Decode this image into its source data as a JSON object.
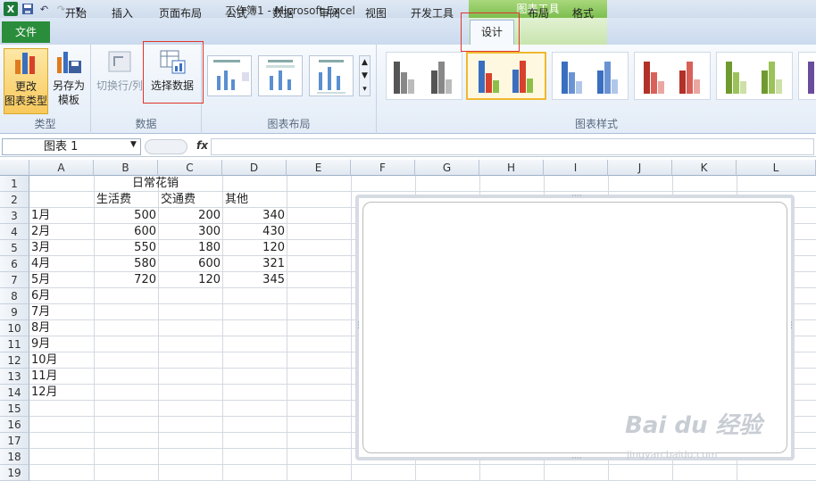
{
  "window": {
    "title": "工作簿1 - Microsoft Excel",
    "context_tab": "图表工具"
  },
  "tabs": [
    "文件",
    "开始",
    "插入",
    "页面布局",
    "公式",
    "数据",
    "审阅",
    "视图",
    "开发工具",
    "设计",
    "布局",
    "格式"
  ],
  "ribbon": {
    "change_type": "更改\n图表类型",
    "save_template": "另存为\n模板",
    "group_type": "类型",
    "switch_rowcol": "切换行/列",
    "select_data": "选择数据",
    "group_data": "数据",
    "group_layout": "图表布局",
    "group_style": "图表样式"
  },
  "formula_bar": {
    "name_box": "图表 1",
    "fx": "fx",
    "value": ""
  },
  "columns": [
    "A",
    "B",
    "C",
    "D",
    "E",
    "F",
    "G",
    "H",
    "I",
    "J",
    "K",
    "L"
  ],
  "rows": [
    "1",
    "2",
    "3",
    "4",
    "5",
    "6",
    "7",
    "8",
    "9",
    "10",
    "11",
    "12",
    "13",
    "14",
    "15",
    "16",
    "17",
    "18",
    "19"
  ],
  "sheet": {
    "title": "日常花销",
    "headers": [
      "生活费",
      "交通费",
      "其他"
    ],
    "data": [
      {
        "month": "1月",
        "a": "500",
        "b": "200",
        "c": "340"
      },
      {
        "month": "2月",
        "a": "600",
        "b": "300",
        "c": "430"
      },
      {
        "month": "3月",
        "a": "550",
        "b": "180",
        "c": "120"
      },
      {
        "month": "4月",
        "a": "580",
        "b": "600",
        "c": "321"
      },
      {
        "month": "5月",
        "a": "720",
        "b": "120",
        "c": "345"
      }
    ],
    "extra_months": [
      "6月",
      "7月",
      "8月",
      "9月",
      "10月",
      "11月",
      "12月"
    ]
  },
  "watermark": {
    "logo": "Bai du 经验",
    "url": "jingyan.baidu.com"
  },
  "colors": {
    "accent_green": "#2a8d3b",
    "highlight_red": "#e0352b"
  }
}
